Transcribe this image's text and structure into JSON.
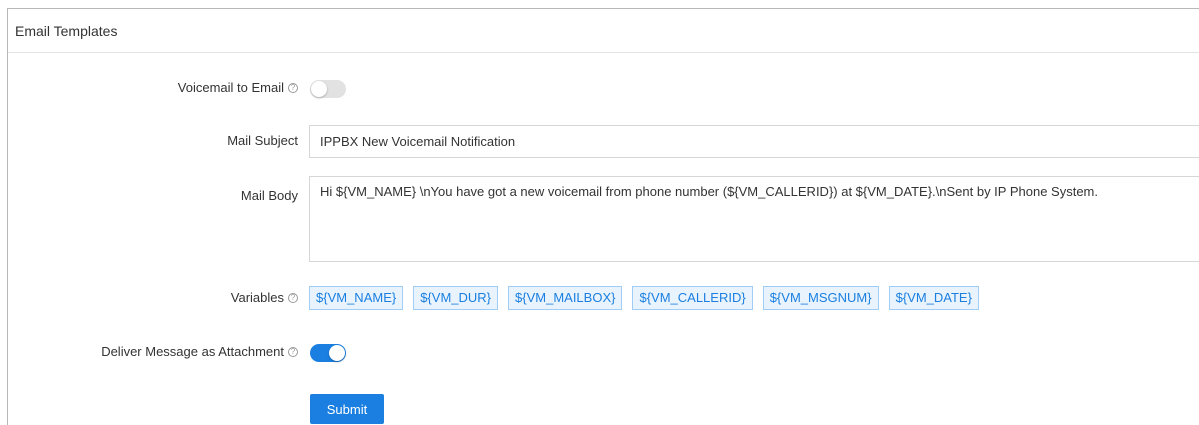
{
  "panel": {
    "title": "Email Templates"
  },
  "form": {
    "voicemail_to_email": {
      "label": "Voicemail to Email",
      "help_icon": "?",
      "enabled": false
    },
    "mail_subject": {
      "label": "Mail Subject",
      "value": "IPPBX New Voicemail Notification"
    },
    "mail_body": {
      "label": "Mail Body",
      "value": "Hi ${VM_NAME} \\nYou have got a new voicemail from phone number (${VM_CALLERID}) at ${VM_DATE}.\\nSent by  IP Phone System."
    },
    "variables": {
      "label": "Variables",
      "help_icon": "?",
      "items": [
        "${VM_NAME}",
        "${VM_DUR}",
        "${VM_MAILBOX}",
        "${VM_CALLERID}",
        "${VM_MSGNUM}",
        "${VM_DATE}"
      ]
    },
    "deliver_as_attachment": {
      "label": "Deliver Message as Attachment",
      "help_icon": "?",
      "enabled": true
    },
    "submit_label": "Submit"
  },
  "colors": {
    "accent": "#1a7fe0",
    "tag_background": "#e8f3fd",
    "tag_border": "#9fcdf5",
    "toggle_off": "#e2e2e2"
  },
  "icons": {
    "help": "question-circle-icon"
  }
}
